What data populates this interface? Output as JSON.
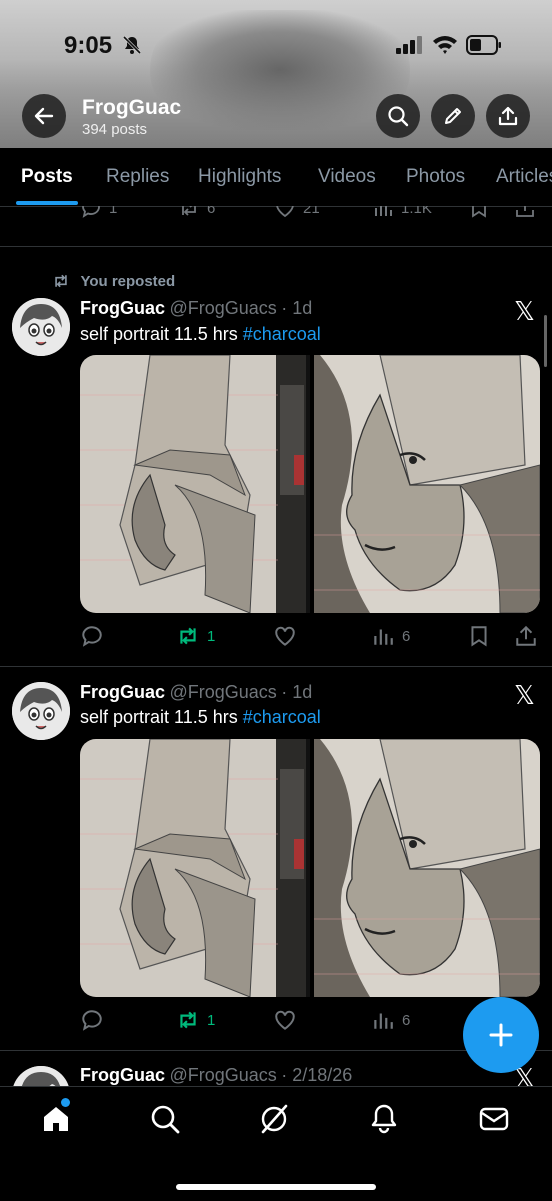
{
  "status_bar": {
    "time": "9:05"
  },
  "header": {
    "name": "FrogGuac",
    "posts_count": "394 posts"
  },
  "tabs": [
    "Posts",
    "Replies",
    "Highlights",
    "Videos",
    "Photos",
    "Articles"
  ],
  "prev_post": {
    "reply_count": "1",
    "repost_count": "6",
    "like_count": "21",
    "views": "1.1K"
  },
  "posts": [
    {
      "repost_label": "You reposted",
      "name": "FrogGuac",
      "handle": "@FrogGuacs",
      "time": "· 1d",
      "text": "self portrait 11.5 hrs ",
      "hashtag": "#charcoal",
      "reposts": "1",
      "views": "6"
    },
    {
      "name": "FrogGuac",
      "handle": "@FrogGuacs",
      "time": "· 1d",
      "text": "self portrait 11.5 hrs ",
      "hashtag": "#charcoal",
      "reposts": "1",
      "views": "6"
    },
    {
      "name": "FrogGuac",
      "handle": "@FrogGuacs",
      "time": "· 2/18/26"
    }
  ],
  "icons": {
    "back": "back-arrow-icon",
    "search": "search-icon",
    "edit": "pencil-icon",
    "share": "share-icon",
    "reply": "reply-icon",
    "repost": "repost-icon",
    "like": "heart-icon",
    "views": "views-icon",
    "bookmark": "bookmark-icon",
    "x_logo": "x-logo-icon",
    "compose": "plus-icon",
    "nav": [
      "home-icon",
      "search-icon",
      "grok-icon",
      "notifications-icon",
      "messages-icon"
    ]
  },
  "colors": {
    "accent": "#1d9bf0",
    "repost_green": "#00ba7c",
    "background": "#000000",
    "muted": "#71767b"
  }
}
